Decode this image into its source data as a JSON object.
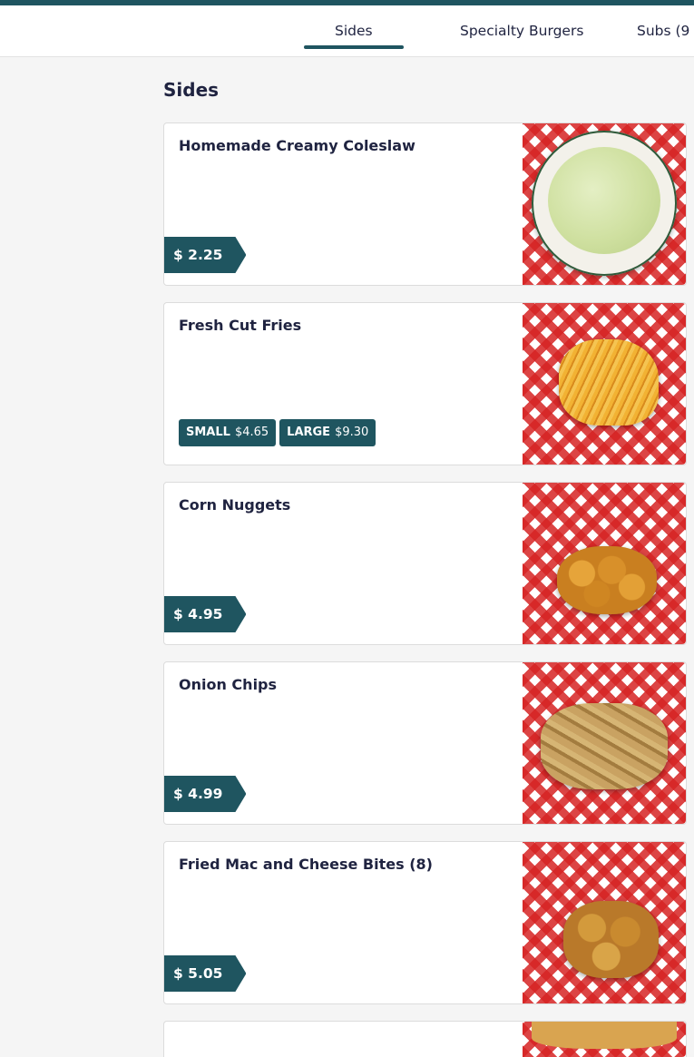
{
  "nav": {
    "tabs": [
      {
        "label": "Sides",
        "active": true
      },
      {
        "label": "Specialty Burgers",
        "active": false
      },
      {
        "label": "Subs (9"
      }
    ]
  },
  "section": {
    "title": "Sides"
  },
  "colors": {
    "brand": "#1f5560",
    "text": "#1f2340",
    "checker_red": "#d62323"
  },
  "items": [
    {
      "name": "Homemade Creamy Coleslaw",
      "price": "$ 2.25",
      "image": "coleslaw-photo"
    },
    {
      "name": "Fresh Cut Fries",
      "sizes": [
        {
          "label": "SMALL",
          "price": "$4.65"
        },
        {
          "label": "LARGE",
          "price": "$9.30"
        }
      ],
      "image": "fries-photo"
    },
    {
      "name": "Corn Nuggets",
      "price": "$ 4.95",
      "image": "corn-nuggets-photo"
    },
    {
      "name": "Onion Chips",
      "price": "$ 4.99",
      "image": "onion-chips-photo"
    },
    {
      "name": "Fried Mac and Cheese Bites (8)",
      "price": "$ 5.05",
      "image": "mac-cheese-bites-photo"
    }
  ]
}
